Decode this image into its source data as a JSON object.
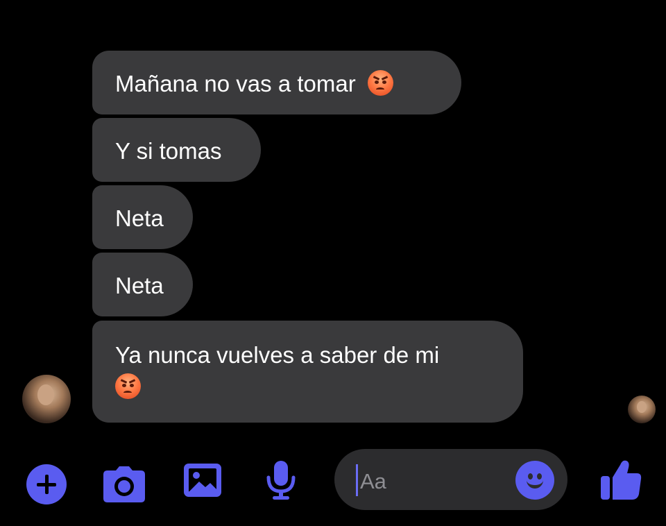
{
  "thread": {
    "messages": [
      {
        "text": "Mañana no vas a tomar",
        "emoji": "pouting-face"
      },
      {
        "text": "Y si tomas"
      },
      {
        "text": "Neta"
      },
      {
        "text": "Neta"
      },
      {
        "text": "Ya nunca vuelves a saber de mi",
        "emoji": "pouting-face"
      }
    ],
    "sender_avatar": "contact-avatar",
    "read_receipt_avatar": "contact-avatar-small"
  },
  "composer": {
    "placeholder": "Aa",
    "icons": [
      "plus-icon",
      "camera-icon",
      "image-icon",
      "microphone-icon",
      "emoji-icon",
      "thumbs-up-icon"
    ]
  },
  "colors": {
    "background": "#000000",
    "bubble": "#3a3a3c",
    "accent": "#5a5cf0",
    "input_background": "#2c2c2e",
    "placeholder": "#8e8e93"
  }
}
